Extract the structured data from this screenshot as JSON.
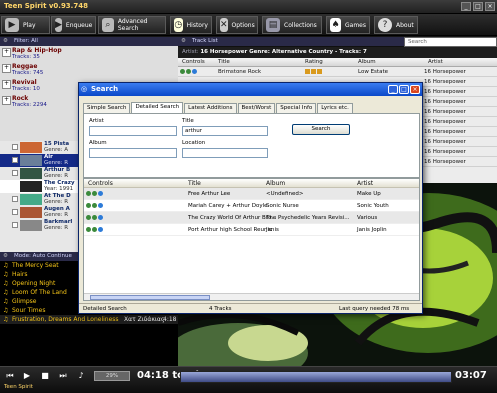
{
  "app": {
    "title": "Teen Spirit v0.93.748",
    "status": "Teen Spirit"
  },
  "toolbar": {
    "play": "Play",
    "enqueue": "Enqueue",
    "advanced_search": "Advanced Search",
    "history": "History",
    "options": "Options",
    "collections": "Collections",
    "games": "Games",
    "about": "About"
  },
  "filter_panel": {
    "title": "Filter: All"
  },
  "filters": [
    {
      "name": "Rap & Hip-Hop",
      "count": "Tracks: 35"
    },
    {
      "name": "Reggae",
      "count": "Tracks: 745"
    },
    {
      "name": "Revival",
      "count": "Tracks: 10"
    },
    {
      "name": "Rock",
      "count": "Tracks: 2294"
    }
  ],
  "albums": [
    {
      "name": "15 Pista",
      "genre": "Genre: A"
    },
    {
      "name": "Air",
      "genre": "Genre: R"
    },
    {
      "name": "Arthur B",
      "genre": "Genre: R"
    },
    {
      "name": "The Crazy",
      "genre": "Year: 1991"
    },
    {
      "name": "At The D",
      "genre": "Genre: R"
    },
    {
      "name": "Augen A",
      "genre": "Genre: R"
    },
    {
      "name": "Barkmarl",
      "genre": "Genre: R"
    }
  ],
  "playlist_panel": {
    "title": "Mode: Auto Continue"
  },
  "playlist": [
    "The Mercy Seat",
    "Hairs",
    "Opening Night",
    "Loom Of The Land",
    "Glimpse",
    "Sour Times"
  ],
  "playlist_current": {
    "title": "Frustration, Dreams And Loneliness",
    "artist": "Χατ Ζιδάκιας",
    "duration": "4:18"
  },
  "tracklist": {
    "title": "Track List",
    "search_placeholder": "Search",
    "info_label": "Artist:",
    "info_value": "16 Horsepower  Genre: Alternative Country - Tracks: 7",
    "headers": {
      "controls": "Controls",
      "title": "Title",
      "rating": "Rating",
      "album": "Album",
      "artist": "Artist"
    },
    "rows": [
      {
        "title": "Brimstone Rock",
        "album": "Low Estate",
        "artist": "16 Horsepower"
      },
      {
        "artist": "16 Horsepower"
      },
      {
        "artist": "16 Horsepower"
      },
      {
        "artist": "16 Horsepower"
      },
      {
        "artist": "16 Horsepower"
      },
      {
        "artist": "16 Horsepower"
      },
      {
        "artist": "16 Horsepower"
      },
      {
        "artist": "16 Horsepower"
      },
      {
        "artist": "16 Horsepower"
      },
      {
        "artist": "16 Horsepower"
      }
    ]
  },
  "search_dialog": {
    "title": "Search",
    "tabs": [
      "Simple Search",
      "Detailed Search",
      "Latest Additions",
      "Best/Worst",
      "Special Info",
      "Lyrics etc."
    ],
    "active_tab": "Detailed Search",
    "artist_label": "Artist",
    "title_label": "Title",
    "title_value": "arthur",
    "album_label": "Album",
    "location_label": "Location",
    "search_button": "Search",
    "results_headers": {
      "controls": "Controls",
      "title": "Title",
      "album": "Album",
      "artist": "Artist"
    },
    "results": [
      {
        "title": "Free Arthur Lee",
        "album": "<Undefined>",
        "artist": "Make Up"
      },
      {
        "title": "Mariah Carey + Arthur Doyle",
        "album": "Sonic Nurse",
        "artist": "Sonic Youth"
      },
      {
        "title": "The Crazy World Of Arthur Bro...",
        "album": "The Psychedelic Years Revisi...",
        "artist": "Various"
      },
      {
        "title": "Port Arthur high School Reunio",
        "album": "Janis",
        "artist": "Janis Joplin"
      }
    ],
    "status_left": "Detailed Search",
    "status_mid": "4 Tracks",
    "status_right": "Last query needed 78 ms"
  },
  "player": {
    "volume": "29%",
    "elapsed": "04:18 total",
    "remaining": "03:07"
  }
}
